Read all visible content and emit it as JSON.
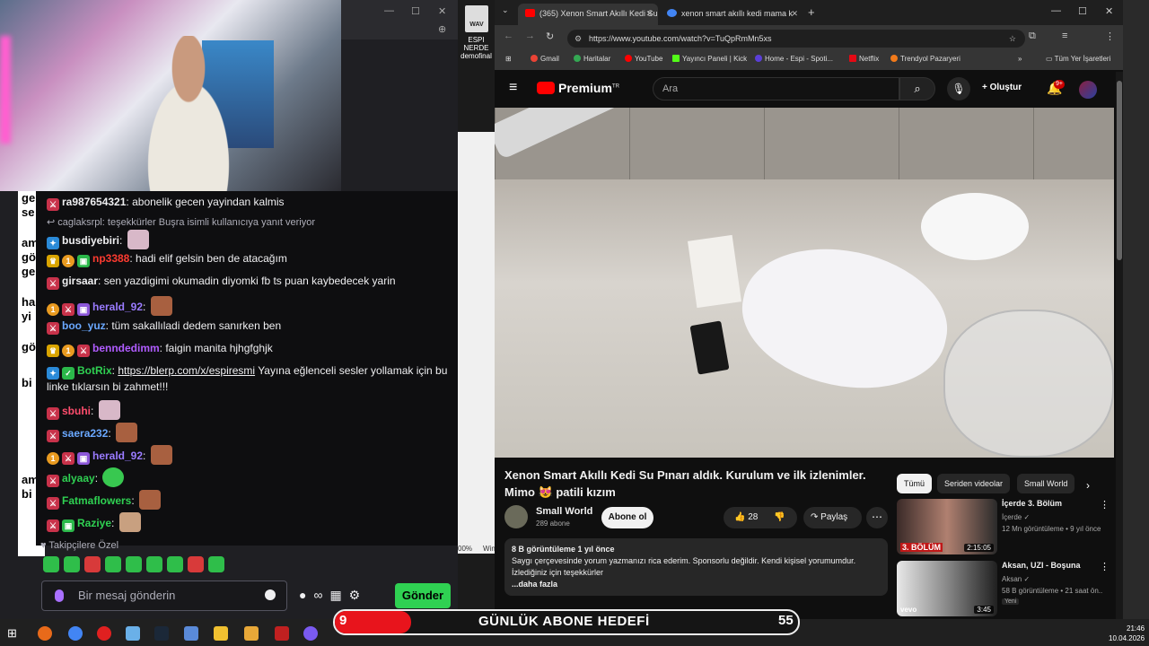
{
  "chat": {
    "messages": [
      {
        "user": "ra987654321",
        "text": "abonelik gecen yayindan kalmis",
        "color": "#efeff1"
      },
      {
        "reply": "↩ caglaksrpl: teşekkürler Buşra isimli kullanıcıya yanıt veriyor"
      },
      {
        "user": "busdiyebiri",
        "text": "",
        "color": "#efeff1"
      },
      {
        "user": "np3388",
        "text": "hadi elif gelsin ben de atacağım",
        "color": "#ff3b30"
      },
      {
        "user": "girsaar",
        "text": "sen yazdigimi okumadin diyomki fb ts puan kaybedecek yarin",
        "color": "#efeff1"
      },
      {
        "user": "herald_92",
        "text": "",
        "color": "#9a7bff"
      },
      {
        "user": "boo_yuz",
        "text": "tüm sakallıladi dedem sanırken ben",
        "color": "#6aa8ff"
      },
      {
        "user": "benndedimm",
        "text": "faigin manita hjhgfghjk",
        "color": "#b05cff"
      },
      {
        "user": "BotRix",
        "link": "https://blerp.com/x/espiresmi",
        "text": "Yayına eğlenceli sesler yollamak için bu",
        "text2": "linke tıklarsın bi zahmet!!!",
        "color": "#2fd152"
      },
      {
        "user": "sbuhi",
        "text": "",
        "color": "#ff4d6d"
      },
      {
        "user": "saera232",
        "text": "",
        "color": "#6aa8ff"
      },
      {
        "user": "herald_92",
        "text": "",
        "color": "#9a7bff"
      },
      {
        "user": "alyaay",
        "text": "",
        "color": "#2fd152"
      },
      {
        "user": "Fatmaflowers",
        "text": "",
        "color": "#2fd152"
      },
      {
        "user": "Raziye",
        "text": "",
        "color": "#2fd152"
      }
    ],
    "followers_only": "Takipçilere Özel",
    "input_placeholder": "Bir mesaj gönderin",
    "send_label": "Gönder"
  },
  "left_text": {
    "lines": [
      "ge",
      "se",
      "am",
      "gö",
      "ge",
      "ha",
      "yi",
      "gö",
      "bi",
      "am",
      "bi"
    ]
  },
  "desktop": {
    "icon_label": "ESPI NERDE demofinal",
    "icon_text": "WAV",
    "zoom": "00%",
    "win": "Win"
  },
  "browser": {
    "tabs": [
      {
        "label": "(365) Xenon Smart Akıllı Kedi Su",
        "active": true
      },
      {
        "label": "xenon smart akıllı kedi mama k",
        "active": false
      }
    ],
    "url": "https://www.youtube.com/watch?v=TuQpRmMn5xs",
    "bookmarks": [
      "Gmail",
      "Haritalar",
      "YouTube",
      "Yayıncı Paneli | Kick",
      "Home - Espi - Spoti...",
      "Netflix",
      "Trendyol Pazaryeri"
    ],
    "all_bookmarks": "Tüm Yer İşaretleri"
  },
  "youtube": {
    "logo": "Premium",
    "logo_tr": "TR",
    "search_placeholder": "Ara",
    "create_label": "Oluştur",
    "notif_count": "9+",
    "video_title": "Xenon Smart Akıllı Kedi Su Pınarı aldık. Kurulum ve ilk izlenimler. Mimo 😻 patili kızım",
    "channel": "Small World",
    "subscribers": "289 abone",
    "subscribe_label": "Abone ol",
    "likes": "28",
    "share_label": "Paylaş",
    "desc_meta": "8 B görüntüleme  1 yıl önce",
    "desc_text": "Saygı çerçevesinde yorum yazmanızı rica ederim. Sponsorlu değildir. Kendi kişisel yorumumdur. İzlediğiniz için teşekkürler",
    "desc_more": "...daha fazla",
    "chips": [
      "Tümü",
      "Seriden videolar",
      "Small World"
    ],
    "recs": [
      {
        "title": "İçerde 3. Bölüm",
        "channel": "İçerde ✓",
        "meta": "12 Mn görüntüleme • 9 yıl önce",
        "duration": "2:15:05",
        "overlay": "3. BÖLÜM",
        "new": ""
      },
      {
        "title": "Aksan, UZI - Boşuna",
        "channel": "Aksan ✓",
        "meta": "58 B görüntüleme • 21 saat ön...",
        "duration": "3:45",
        "overlay": "vevo",
        "new": "Yeni"
      }
    ]
  },
  "goal": {
    "current": "9",
    "label": "GÜNLÜK ABONE HEDEFİ",
    "max": "55",
    "progress": 0.164
  },
  "taskbar": {
    "time": "21:46",
    "date": "10.04.2026"
  }
}
